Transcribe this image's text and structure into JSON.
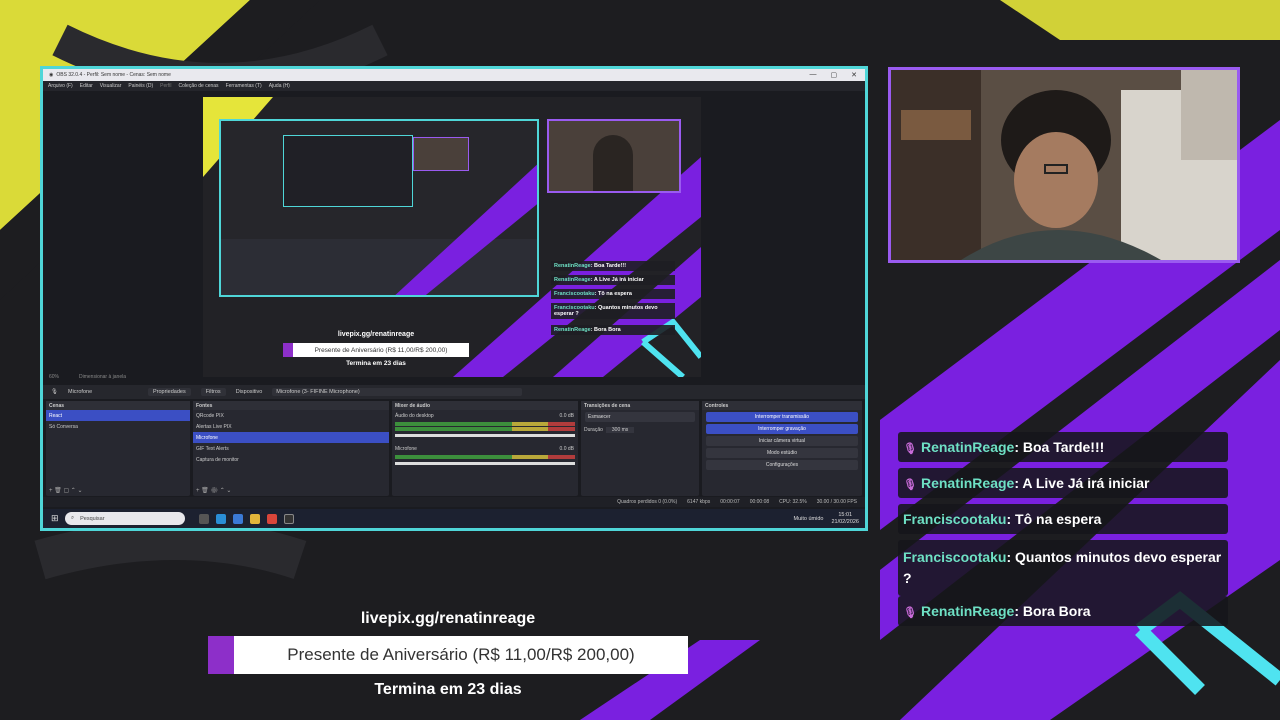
{
  "obs": {
    "window_title": "OBS 32.0.4 - Perfil: Sem nome - Cenas: Sem nome",
    "menu": [
      "Arquivo (F)",
      "Editar",
      "Visualizar",
      "Painéis (D)",
      "Perfil",
      "Coleção de cenas",
      "Ferramentas (T)",
      "Ajuda (H)"
    ],
    "zoom": "60%",
    "zoom_mode": "Dimensionar à janela",
    "source_bar": {
      "source": "Microfone",
      "properties": "Propriedades",
      "filters": "Filtros",
      "device_label": "Dispositivo",
      "device_value": "Microfone (3- FIFINE Microphone)"
    },
    "docks": {
      "scenes": {
        "title": "Cenas",
        "items": [
          "React",
          "Só Conversa"
        ]
      },
      "sources": {
        "title": "Fontes",
        "items": [
          "QRcode PIX",
          "Alertas Live PIX",
          "Microfone",
          "GIF Text Alerts",
          "Captura de monitor"
        ]
      },
      "mixer": {
        "title": "Mixer de áudio",
        "ch1": "Áudio do desktop",
        "ch1_db": "0.0 dB",
        "ch2": "Microfone",
        "ch2_db": "0.0 dB"
      },
      "transitions": {
        "title": "Transições de cena",
        "type": "Esmaecer",
        "duration_label": "Duração",
        "duration": "300 ms"
      },
      "controls": {
        "title": "Controles",
        "buttons": [
          "Interromper transmissão",
          "Interromper gravação",
          "Iniciar câmera virtual",
          "Modo estúdio",
          "Configurações"
        ]
      }
    },
    "status": {
      "dropped": "Quadros perdidos 0 (0.0%)",
      "kbps": "6147 kbps",
      "stream_time": "00:00:07",
      "rec_time": "00:00:08",
      "cpu": "CPU: 32.5%",
      "fps": "30.00 / 30.00 FPS"
    },
    "taskbar": {
      "search": "Pesquisar",
      "weather": "Muito úmido",
      "time": "15:01",
      "date": "21/02/2026"
    }
  },
  "chat": [
    {
      "user": "RenatinReage",
      "text": ": Boa Tarde!!!",
      "mic": true
    },
    {
      "user": "RenatinReage",
      "text": ": A Live Já irá iniciar",
      "mic": true
    },
    {
      "user": "Franciscootaku",
      "text": ": Tô na espera",
      "mic": false
    },
    {
      "user": "Franciscootaku",
      "text": ": Quantos minutos devo esperar ?",
      "mic": false
    },
    {
      "user": "RenatinReage",
      "text": ": Bora Bora",
      "mic": true
    }
  ],
  "donation": {
    "url": "livepix.gg/renatinreage",
    "goal": "Presente de Aniversário (R$ 11,00/R$ 200,00)",
    "remaining": "Termina em 23 dias",
    "progress": 0.055
  },
  "colors": {
    "accent_cyan": "#4fd6d8",
    "accent_purple": "#8d2fc9",
    "obs_blue": "#3b4fc4",
    "user_color": "#6ee0c4"
  }
}
